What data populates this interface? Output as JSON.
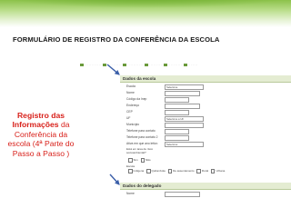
{
  "page": {
    "title": "FORMULÁRIO DE REGISTRO DA CONFERÊNCIA DA ESCOLA",
    "side_note": {
      "bold": "Registro das Informações",
      "rest": "da Conferência da escola (4ª Parte do Passo a Passo )"
    },
    "colors": {
      "title": "#1a1a1a",
      "side_note": "#d8211b",
      "band": "#8cc24a",
      "arrow": "#3a5ea8"
    }
  },
  "screenshot": {
    "section1": {
      "title": "Dados da escola",
      "fields": [
        {
          "label": "Escola",
          "value": "Selecione"
        },
        {
          "label": "Nome",
          "value": ""
        },
        {
          "label": "Código da Inep",
          "value": ""
        },
        {
          "label": "Endereço",
          "value": ""
        },
        {
          "label": "CEP",
          "value": ""
        },
        {
          "label": "UF",
          "value": "Selecione a UF"
        },
        {
          "label": "Município",
          "value": ""
        },
        {
          "label": "Telefone para contato",
          "value": ""
        },
        {
          "label": "Telefone para contato 2",
          "value": ""
        },
        {
          "label": "Ativa em que ano letivo",
          "value": "Selecione"
        }
      ],
      "question": "Está em área de risco socioambiental?",
      "question_options": [
        "Sim",
        "Não"
      ],
      "zone_label": "Escola",
      "zone_options": [
        "Indígena",
        "Quilombola",
        "De assentamento",
        "Rural",
        "Urbana"
      ]
    },
    "section2": {
      "title": "Dados do delegado",
      "fields": [
        {
          "label": "Nome",
          "value": ""
        }
      ]
    }
  }
}
